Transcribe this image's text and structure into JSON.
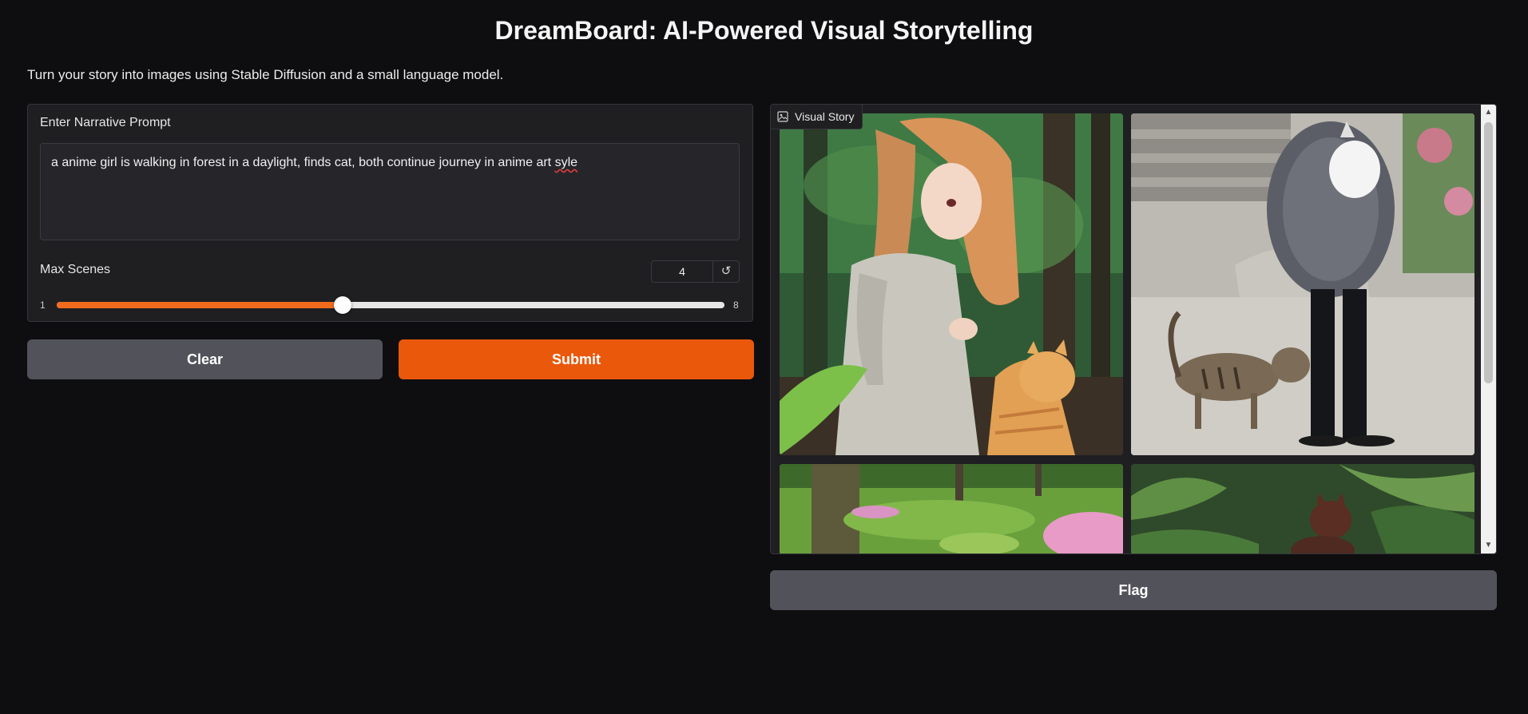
{
  "app": {
    "title": "DreamBoard: AI-Powered Visual Storytelling",
    "description": "Turn your story into images using Stable Diffusion and a small language model."
  },
  "prompt": {
    "label": "Enter Narrative Prompt",
    "value_main": "a anime girl is walking in forest in a daylight, finds cat, both continue journey in anime art ",
    "value_misspelled": "syle"
  },
  "max_scenes": {
    "label": "Max Scenes",
    "value": "4",
    "min": "1",
    "max": "8",
    "fraction": 0.4286,
    "reset_icon": "reset-icon"
  },
  "buttons": {
    "clear": "Clear",
    "submit": "Submit",
    "flag": "Flag"
  },
  "gallery": {
    "label": "Visual Story",
    "label_icon": "image-icon",
    "images": [
      {
        "alt": "anime girl in forest with orange cat"
      },
      {
        "alt": "person in fur coat holding white cat, tabby cat walking"
      },
      {
        "alt": "forest clearing with pink flowers"
      },
      {
        "alt": "brown cat among ferns"
      }
    ]
  },
  "colors": {
    "background": "#0e0e10",
    "panel": "#1f1f22",
    "accent": "#ea580c",
    "slider_fill": "#f26b1d",
    "secondary_button": "#52525b"
  }
}
